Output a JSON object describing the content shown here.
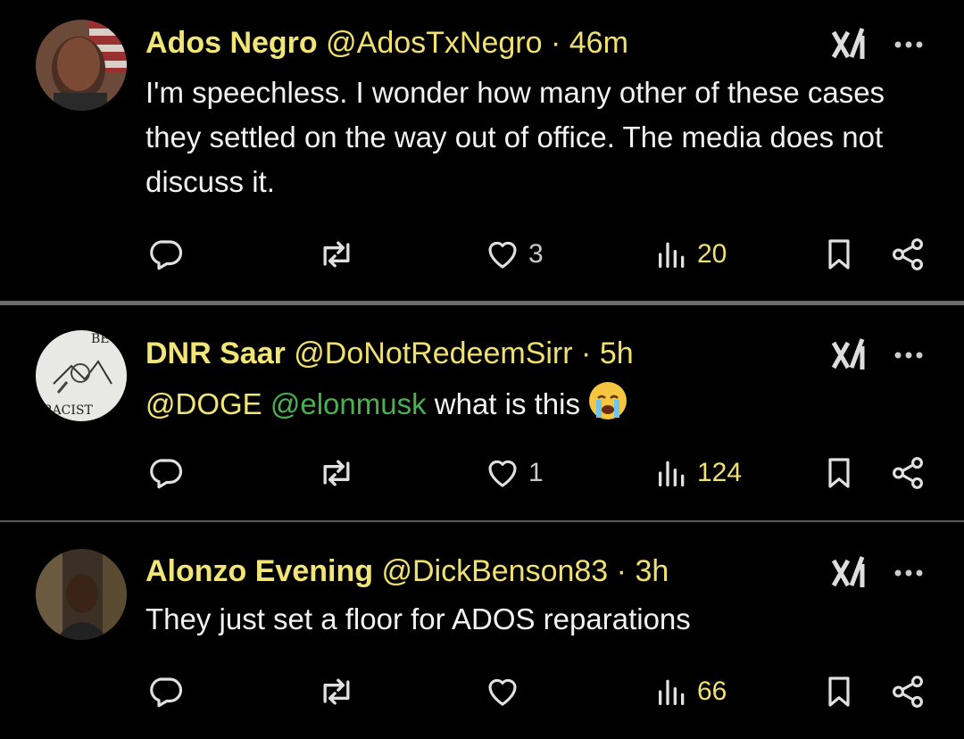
{
  "tweets": [
    {
      "name": "Ados Negro",
      "handle": "@AdosTxNegro",
      "dot": "·",
      "time": "46m",
      "text": "I'm speechless.  I wonder how many other of these cases they settled on the way out of office.  The media does not discuss it.",
      "likes": "3",
      "views": "20"
    },
    {
      "name": "DNR Saar",
      "handle": "@DoNotRedeemSirr",
      "dot": "·",
      "time": "5h",
      "mention1": "@DOGE",
      "mention2": "@elonmusk",
      "text": "what is this",
      "likes": "1",
      "views": "124"
    },
    {
      "name": "Alonzo Evening",
      "handle": "@DickBenson83",
      "dot": "·",
      "time": "3h",
      "text": "They just set a floor for ADOS reparations",
      "likes": "",
      "views": "66"
    }
  ],
  "icons": {
    "reply": "reply-icon",
    "repost": "repost-icon",
    "like": "heart-icon",
    "views": "views-icon",
    "bookmark": "bookmark-icon",
    "share": "share-icon",
    "grok": "grok-icon",
    "more": "more-icon",
    "emoji": "loudly-crying-face-emoji"
  },
  "colors": {
    "background": "#000000",
    "name": "#f2e577",
    "mention_green": "#4caf50",
    "divider": "#5a5a5a"
  }
}
